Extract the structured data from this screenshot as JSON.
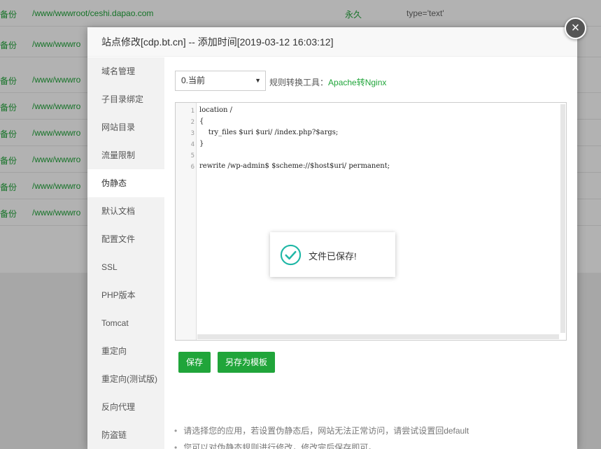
{
  "background_rows": [
    {
      "backup": "备份",
      "path": "/www/wwwroot/ceshi.dapao.com",
      "expire": "永久",
      "type": "type='text'"
    },
    {
      "backup": "备份",
      "path": "/www/wwwro"
    },
    {
      "backup": "备份",
      "path": "/www/wwwro"
    },
    {
      "backup": "备份",
      "path": "/www/wwwro"
    },
    {
      "backup": "备份",
      "path": "/www/wwwro"
    },
    {
      "backup": "备份",
      "path": "/www/wwwro"
    },
    {
      "backup": "备份",
      "path": "/www/wwwro"
    },
    {
      "backup": "备份",
      "path": "/www/wwwro"
    }
  ],
  "modal": {
    "title": "站点修改[cdp.bt.cn] -- 添加时间[2019-03-12 16:03:12]",
    "close_glyph": "×"
  },
  "side_menu": [
    "域名管理",
    "子目录绑定",
    "网站目录",
    "流量限制",
    "伪静态",
    "默认文档",
    "配置文件",
    "SSL",
    "PHP版本",
    "Tomcat",
    "重定向",
    "重定向(测试版)",
    "反向代理",
    "防盗链"
  ],
  "active_menu_index": 4,
  "rewrite": {
    "select_value": "0.当前",
    "select_arrow": "▼",
    "converter_label": "规则转换工具：",
    "converter_link": "Apache转Nginx"
  },
  "editor": {
    "lines": [
      {
        "n": "1",
        "text": "location /"
      },
      {
        "n": "2",
        "text": "{"
      },
      {
        "n": "3",
        "text": "    try_files $uri $uri/ /index.php?$args;"
      },
      {
        "n": "4",
        "text": "}"
      },
      {
        "n": "5",
        "text": ""
      },
      {
        "n": "6",
        "text": "rewrite /wp-admin$ $scheme://$host$uri/ permanent;"
      }
    ]
  },
  "buttons": {
    "save": "保存",
    "save_as_template": "另存为模板"
  },
  "tips": [
    "请选择您的应用，若设置伪静态后，网站无法正常访问，请尝试设置回default",
    "您可以对伪静态规则进行修改，修改完后保存即可。"
  ],
  "toast": {
    "message": "文件已保存!",
    "icon": "check-circle-icon",
    "color": "#1fb7a6"
  },
  "colors": {
    "accent": "#20a53a"
  }
}
